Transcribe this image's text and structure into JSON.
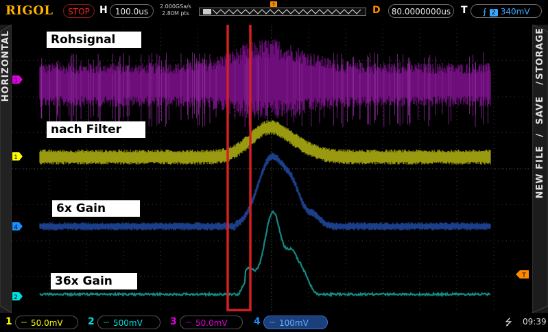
{
  "header": {
    "brand": "RIGOL",
    "run_status": "STOP",
    "horizontal_label": "H",
    "timebase": "100.0us",
    "sample_rate": "2.000GSa/s",
    "memory_depth": "2.80M pts",
    "delay_label": "D",
    "delay": "80.0000000us",
    "trigger_label": "T",
    "trigger_channel": "2",
    "trigger_level": "340mV"
  },
  "side_tabs": {
    "left": "HORIZONTAL",
    "right_top": "STORAGE",
    "right_mid": "SAVE",
    "right_bottom": "NEW FILE",
    "separator": "/"
  },
  "annotations": {
    "raw": "Rohsignal",
    "filtered": "nach Filter",
    "gain6": "6x Gain",
    "gain36": "36x Gain"
  },
  "channels": [
    {
      "num": "1",
      "scale": "50.0mV",
      "color": "#ffff00"
    },
    {
      "num": "2",
      "scale": "500mV",
      "color": "#00e0e0"
    },
    {
      "num": "3",
      "scale": "50.0mV",
      "color": "#e000e0"
    },
    {
      "num": "4",
      "scale": "100mV",
      "color": "#1a6fff"
    }
  ],
  "status_bar": {
    "time": "09:39"
  },
  "colors": {
    "ch1": "#9a9a10",
    "ch2": "#138a84",
    "ch3": "#6d0e7a",
    "ch4": "#1b3f8a",
    "highlight_box": "#d42020",
    "trigger_marker": "#ff8a00"
  }
}
